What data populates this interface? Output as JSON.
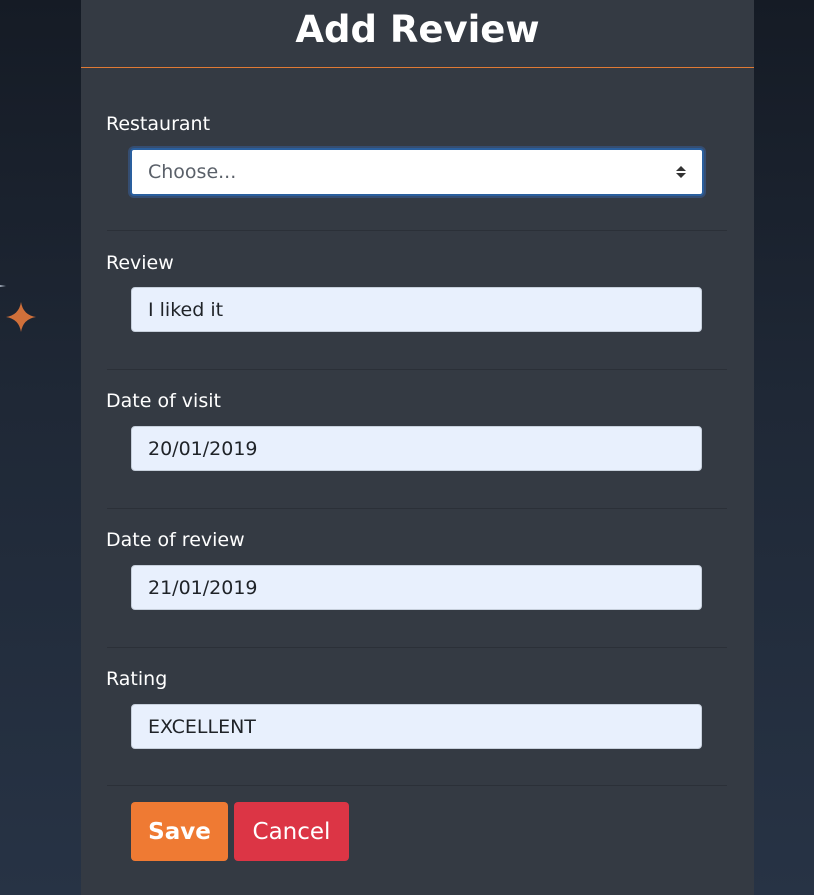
{
  "page": {
    "title": "Add Review"
  },
  "form": {
    "restaurant": {
      "label": "Restaurant",
      "value": "Choose..."
    },
    "review": {
      "label": "Review",
      "value": "I liked it"
    },
    "date_of_visit": {
      "label": "Date of visit",
      "value": "20/01/2019"
    },
    "date_of_review": {
      "label": "Date of review",
      "value": "21/01/2019"
    },
    "rating": {
      "label": "Rating",
      "value": "EXCELLENT"
    }
  },
  "actions": {
    "save_label": "Save",
    "cancel_label": "Cancel"
  },
  "colors": {
    "accent": "#ef7a33",
    "danger": "#dc3545",
    "panel": "#343a43"
  },
  "icons": {
    "decor": "sparkle-icon",
    "select": "select-arrows-icon"
  }
}
